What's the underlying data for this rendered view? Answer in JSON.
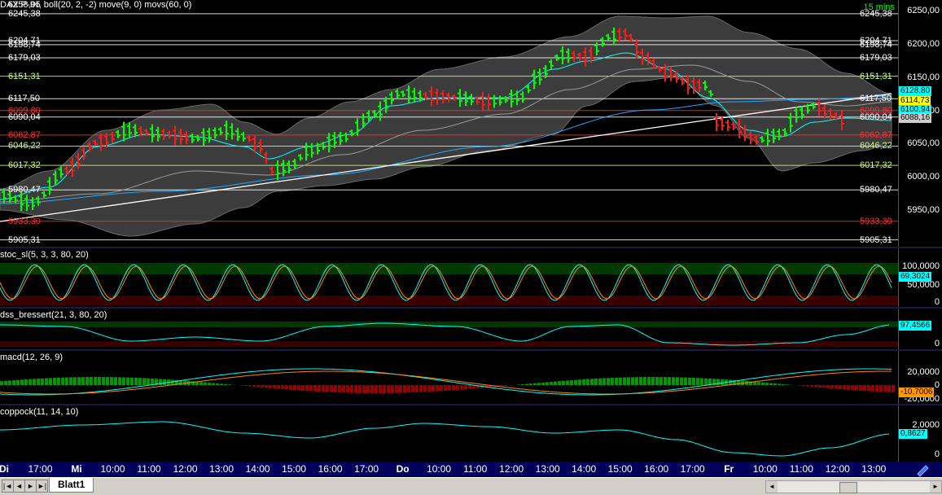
{
  "main": {
    "header": "DAX P-IN, boll(20, 2, -2) move(9, 0) movs(60, 0)",
    "interval": "15 mins",
    "left_levels": [
      {
        "text": "6258,95",
        "price": 6258.95,
        "color": "#ffffff"
      },
      {
        "text": "6245,38",
        "price": 6245.38,
        "color": "#ffffff"
      },
      {
        "text": "6204,71",
        "price": 6204.71,
        "color": "#ffffff"
      },
      {
        "text": "6198,74",
        "price": 6198.74,
        "color": "#ffffff"
      },
      {
        "text": "6179,03",
        "price": 6179.03,
        "color": "#ffffff"
      },
      {
        "text": "6151,31",
        "price": 6151.31,
        "color": "#ccff66"
      },
      {
        "text": "6117,50",
        "price": 6117.5,
        "color": "#ffffff"
      },
      {
        "text": "6099,80",
        "price": 6099.8,
        "color": "#ff3030"
      },
      {
        "text": "6090,04",
        "price": 6090.04,
        "color": "#ffffff"
      },
      {
        "text": "6062,87",
        "price": 6062.87,
        "color": "#ff3030"
      },
      {
        "text": "6046,22",
        "price": 6046.22,
        "color": "#ccff66"
      },
      {
        "text": "6017,32",
        "price": 6017.32,
        "color": "#ccff66"
      },
      {
        "text": "5980,47",
        "price": 5980.47,
        "color": "#ffffff"
      },
      {
        "text": "5933,30",
        "price": 5933.3,
        "color": "#ff3030"
      },
      {
        "text": "5905,31",
        "price": 5905.31,
        "color": "#ffffff"
      }
    ],
    "right_levels": [
      {
        "text": "6245,38",
        "price": 6245.38,
        "color": "#ffffff"
      },
      {
        "text": "6204,71",
        "price": 6204.71,
        "color": "#ffffff"
      },
      {
        "text": "6198,74",
        "price": 6198.74,
        "color": "#ffffff"
      },
      {
        "text": "6179,03",
        "price": 6179.03,
        "color": "#ffffff"
      },
      {
        "text": "6151,31",
        "price": 6151.31,
        "color": "#ccff66"
      },
      {
        "text": "6117,50",
        "price": 6117.5,
        "color": "#ffffff"
      },
      {
        "text": "6099,80",
        "price": 6099.8,
        "color": "#ff3030"
      },
      {
        "text": "6090,04",
        "price": 6090.04,
        "color": "#ffffff"
      },
      {
        "text": "6062,87",
        "price": 6062.87,
        "color": "#ff3030"
      },
      {
        "text": "6046,22",
        "price": 6046.22,
        "color": "#ccff66"
      },
      {
        "text": "6017,32",
        "price": 6017.32,
        "color": "#ccff66"
      },
      {
        "text": "5980,47",
        "price": 5980.47,
        "color": "#ffffff"
      },
      {
        "text": "5933,30",
        "price": 5933.3,
        "color": "#ff3030"
      },
      {
        "text": "5905,31",
        "price": 5905.31,
        "color": "#ffffff"
      }
    ],
    "axis_ticks": [
      "6250,00",
      "6200,00",
      "6150,00",
      "6100,00",
      "6050,00",
      "6000,00",
      "5950,00"
    ],
    "axis_tick_values": [
      6250,
      6200,
      6150,
      6100,
      6050,
      6000,
      5950
    ],
    "tags": [
      {
        "text": "6128,80",
        "price": 6128.8,
        "bg": "#00ffff"
      },
      {
        "text": "6114,73",
        "price": 6114.73,
        "bg": "#ffff00"
      },
      {
        "text": "6100,94",
        "price": 6100.94,
        "bg": "#00ffff"
      },
      {
        "text": "6088,16",
        "price": 6088.16,
        "bg": "#cccccc"
      }
    ]
  },
  "stoc": {
    "header": "stoc_sl(5, 3, 3, 80, 20)",
    "ticks": [
      "100,0000",
      "50,0000",
      "0"
    ],
    "tag": "69,3024"
  },
  "dss": {
    "header": "dss_bressert(21, 3, 80, 20)",
    "ticks": [
      "0"
    ],
    "tag": "97,4566"
  },
  "macd": {
    "header": "macd(12, 26, 9)",
    "ticks": [
      "20,0000",
      "0",
      "-20,0000"
    ],
    "tag": "-10,7006"
  },
  "coppock": {
    "header": "coppock(11, 14, 10)",
    "ticks": [
      "2,0000",
      "0"
    ],
    "tag": "0,8627"
  },
  "timeaxis": [
    {
      "label": "Di",
      "bold": true
    },
    {
      "label": "17:00",
      "bold": false
    },
    {
      "label": "Mi",
      "bold": true
    },
    {
      "label": "10:00",
      "bold": false
    },
    {
      "label": "11:00",
      "bold": false
    },
    {
      "label": "12:00",
      "bold": false
    },
    {
      "label": "13:00",
      "bold": false
    },
    {
      "label": "14:00",
      "bold": false
    },
    {
      "label": "15:00",
      "bold": false
    },
    {
      "label": "16:00",
      "bold": false
    },
    {
      "label": "17:00",
      "bold": false
    },
    {
      "label": "Do",
      "bold": true
    },
    {
      "label": "10:00",
      "bold": false
    },
    {
      "label": "11:00",
      "bold": false
    },
    {
      "label": "12:00",
      "bold": false
    },
    {
      "label": "13:00",
      "bold": false
    },
    {
      "label": "14:00",
      "bold": false
    },
    {
      "label": "15:00",
      "bold": false
    },
    {
      "label": "16:00",
      "bold": false
    },
    {
      "label": "17:00",
      "bold": false
    },
    {
      "label": "Fr",
      "bold": true
    },
    {
      "label": "10:00",
      "bold": false
    },
    {
      "label": "11:00",
      "bold": false
    },
    {
      "label": "12:00",
      "bold": false
    },
    {
      "label": "13:00",
      "bold": false
    }
  ],
  "bottombar": {
    "sheet_tab": "Blatt1",
    "nav": [
      "|◄",
      "◄",
      "►",
      "►|"
    ]
  },
  "colors": {
    "up": "#00ff00",
    "down": "#ff1a1a",
    "bollinger_fill": "#3c3c3c",
    "ma_fast": "#00ffff",
    "ma_slow": "#9a9a9a",
    "obzone": "#003a00",
    "oszone": "#3a0000"
  }
}
